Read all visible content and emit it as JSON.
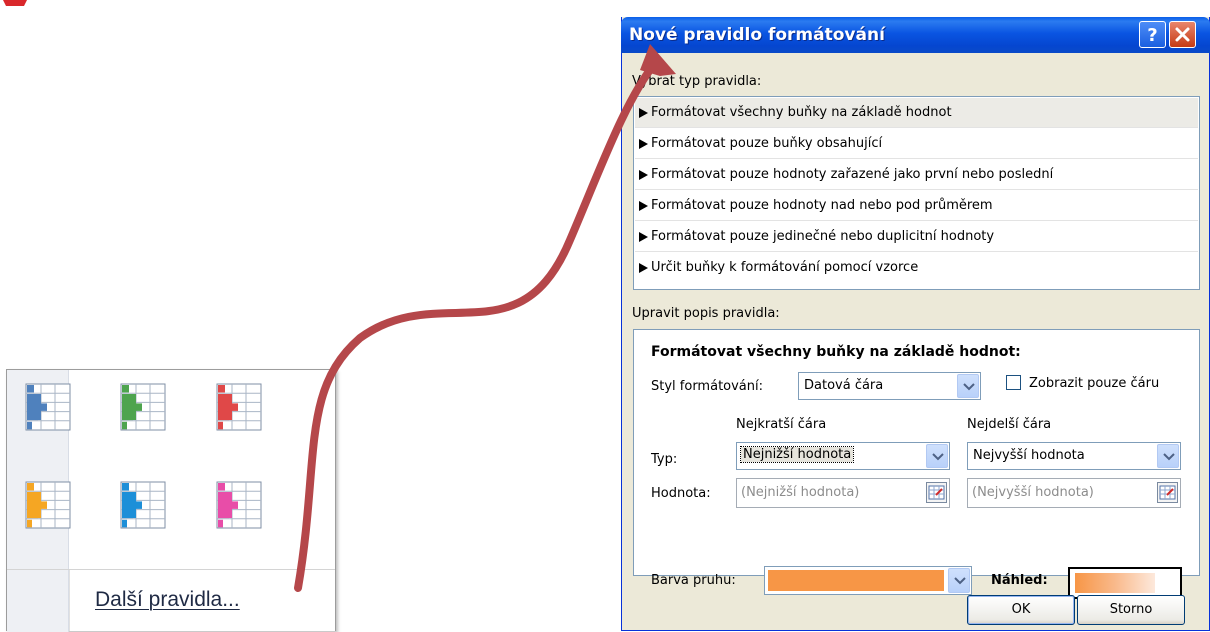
{
  "gallery": {
    "tiles": [
      {
        "name": "blue",
        "color": "#4f81bd"
      },
      {
        "name": "green",
        "color": "#4ea44e"
      },
      {
        "name": "red",
        "color": "#e04848"
      },
      {
        "name": "orange",
        "color": "#f5a623"
      },
      {
        "name": "light-blue",
        "color": "#1d8fd8"
      },
      {
        "name": "pink",
        "color": "#e84da8"
      }
    ],
    "more_rules": "Další pravidla..."
  },
  "dialog": {
    "title": "Nové pravidlo formátování",
    "select_type_label": "Vybrat typ pravidla:",
    "rule_types": [
      "Formátovat všechny buňky na základě hodnot",
      "Formátovat pouze buňky obsahující",
      "Formátovat pouze hodnoty zařazené jako první nebo poslední",
      "Formátovat pouze hodnoty nad nebo pod průměrem",
      "Formátovat pouze jedinečné nebo duplicitní hodnoty",
      "Určit buňky k formátování pomocí vzorce"
    ],
    "edit_label": "Upravit popis pravidla:",
    "section_title": "Formátovat všechny buňky na základě hodnot:",
    "format_style_label": "Styl formátování:",
    "format_style_value": "Datová čára",
    "show_bar_only_label": "Zobrazit pouze čáru",
    "shortest_bar": "Nejkratší čára",
    "longest_bar": "Nejdelší čára",
    "type_label": "Typ:",
    "type_min_value": "Nejnižší hodnota",
    "type_max_value": "Nejvyšší hodnota",
    "value_label": "Hodnota:",
    "value_min_placeholder": "(Nejnižší hodnota)",
    "value_max_placeholder": "(Nejvyšší hodnota)",
    "bar_color_label": "Barva pruhu:",
    "bar_color": "#f79646",
    "preview_label": "Náhled:",
    "ok": "OK",
    "cancel": "Storno"
  },
  "arrow_color": "#b5474a"
}
